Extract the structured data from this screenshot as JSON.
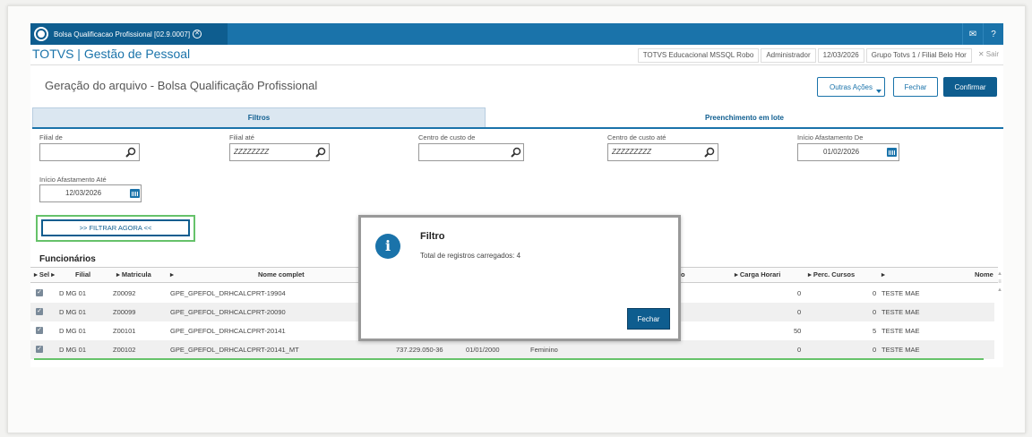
{
  "topbar": {
    "tab_title": "Bolsa Qualificacao Profissional [02.9.0007]",
    "close_symbol": "✕",
    "mail_symbol": "✉",
    "help_symbol": "?"
  },
  "header": {
    "app_title": "TOTVS | Gestão de Pessoal",
    "database": "TOTVS Educacional MSSQL Robo",
    "user": "Administrador",
    "date": "12/03/2026",
    "branch": "Grupo Totvs 1 / Filial Belo Hor",
    "logout_label": "✕ Sair"
  },
  "page": {
    "title": "Geração do arquivo - Bolsa Qualificação Profissional",
    "other_actions_label": "Outras Ações",
    "close_label": "Fechar",
    "confirm_label": "Confirmar"
  },
  "tabs": {
    "filters": "Filtros",
    "batch": "Preenchimento em lote"
  },
  "filters": {
    "filial_de_label": "Filial de",
    "filial_de_value": "",
    "filial_ate_label": "Filial até",
    "filial_ate_value": "ZZZZZZZZ",
    "cc_de_label": "Centro de custo de",
    "cc_de_value": "",
    "cc_ate_label": "Centro de custo até",
    "cc_ate_value": "ZZZZZZZZZ",
    "afast_de_label": "Início Afastamento De",
    "afast_de_value": "01/02/2026",
    "afast_ate_label": "Início Afastamento Até",
    "afast_ate_value": "12/03/2026",
    "filter_now_label": ">> FILTRAR AGORA <<"
  },
  "table": {
    "section_title": "Funcionários",
    "columns": {
      "sel": "Sel",
      "filial": "Filial",
      "matricula": "Matricula",
      "nome": "Nome complet",
      "o_partial": "o",
      "carga": "Carga Horari",
      "perc": "Perc. Cursos",
      "nome2": "Nome"
    },
    "rows": [
      {
        "filial": "D MG 01",
        "matricula": "Z00092",
        "nome": "GPE_GPEFOL_DRHCALCPRT-19904",
        "cpf": "",
        "data": "",
        "sexo": "",
        "carga": "0",
        "perc": "0",
        "nome2": "TESTE MAE"
      },
      {
        "filial": "D MG 01",
        "matricula": "Z00099",
        "nome": "GPE_GPEFOL_DRHCALCPRT-20090",
        "cpf": "",
        "data": "",
        "sexo": "",
        "carga": "0",
        "perc": "0",
        "nome2": "TESTE MAE"
      },
      {
        "filial": "D MG 01",
        "matricula": "Z00101",
        "nome": "GPE_GPEFOL_DRHCALCPRT-20141",
        "cpf": "",
        "data": "",
        "sexo": "",
        "carga": "50",
        "perc": "5",
        "nome2": "TESTE MAE"
      },
      {
        "filial": "D MG 01",
        "matricula": "Z00102",
        "nome": "GPE_GPEFOL_DRHCALCPRT-20141_MT",
        "cpf": "737.229.050-36",
        "data": "01/01/2000",
        "sexo": "Feminino",
        "carga": "0",
        "perc": "0",
        "nome2": "TESTE MAE"
      }
    ]
  },
  "modal": {
    "title": "Filtro",
    "message": "Total de registros carregados: 4",
    "button": "Fechar",
    "icon_glyph": "i"
  },
  "colors": {
    "accent": "#1a73aa",
    "accent_dark": "#0e5d8f",
    "highlight_green": "#66c26a"
  }
}
